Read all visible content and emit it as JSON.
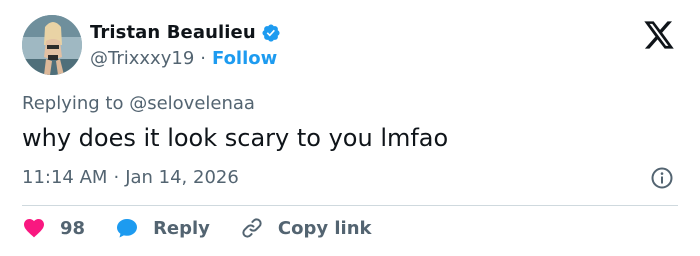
{
  "author": {
    "name": "Tristan Beaulieu",
    "handle": "@Trixxxy19",
    "follow_label": "Follow",
    "verified": true
  },
  "reply_context": {
    "prefix": "Replying to",
    "mention": "@selovelenaa"
  },
  "tweet": {
    "text": "why does it look scary to you lmfao",
    "time": "11:14 AM",
    "date": "Jan 14, 2026"
  },
  "actions": {
    "likes": "98",
    "reply_label": "Reply",
    "copy_label": "Copy link"
  },
  "icons": {
    "verified": "verified-badge-icon",
    "logo": "x-logo-icon",
    "info": "info-icon",
    "like": "heart-icon",
    "reply": "speech-bubble-icon",
    "copy": "link-icon"
  },
  "colors": {
    "text": "#0f1419",
    "muted": "#536471",
    "accent": "#1d9bf0",
    "like": "#f91880",
    "divider": "#cfd9de"
  }
}
